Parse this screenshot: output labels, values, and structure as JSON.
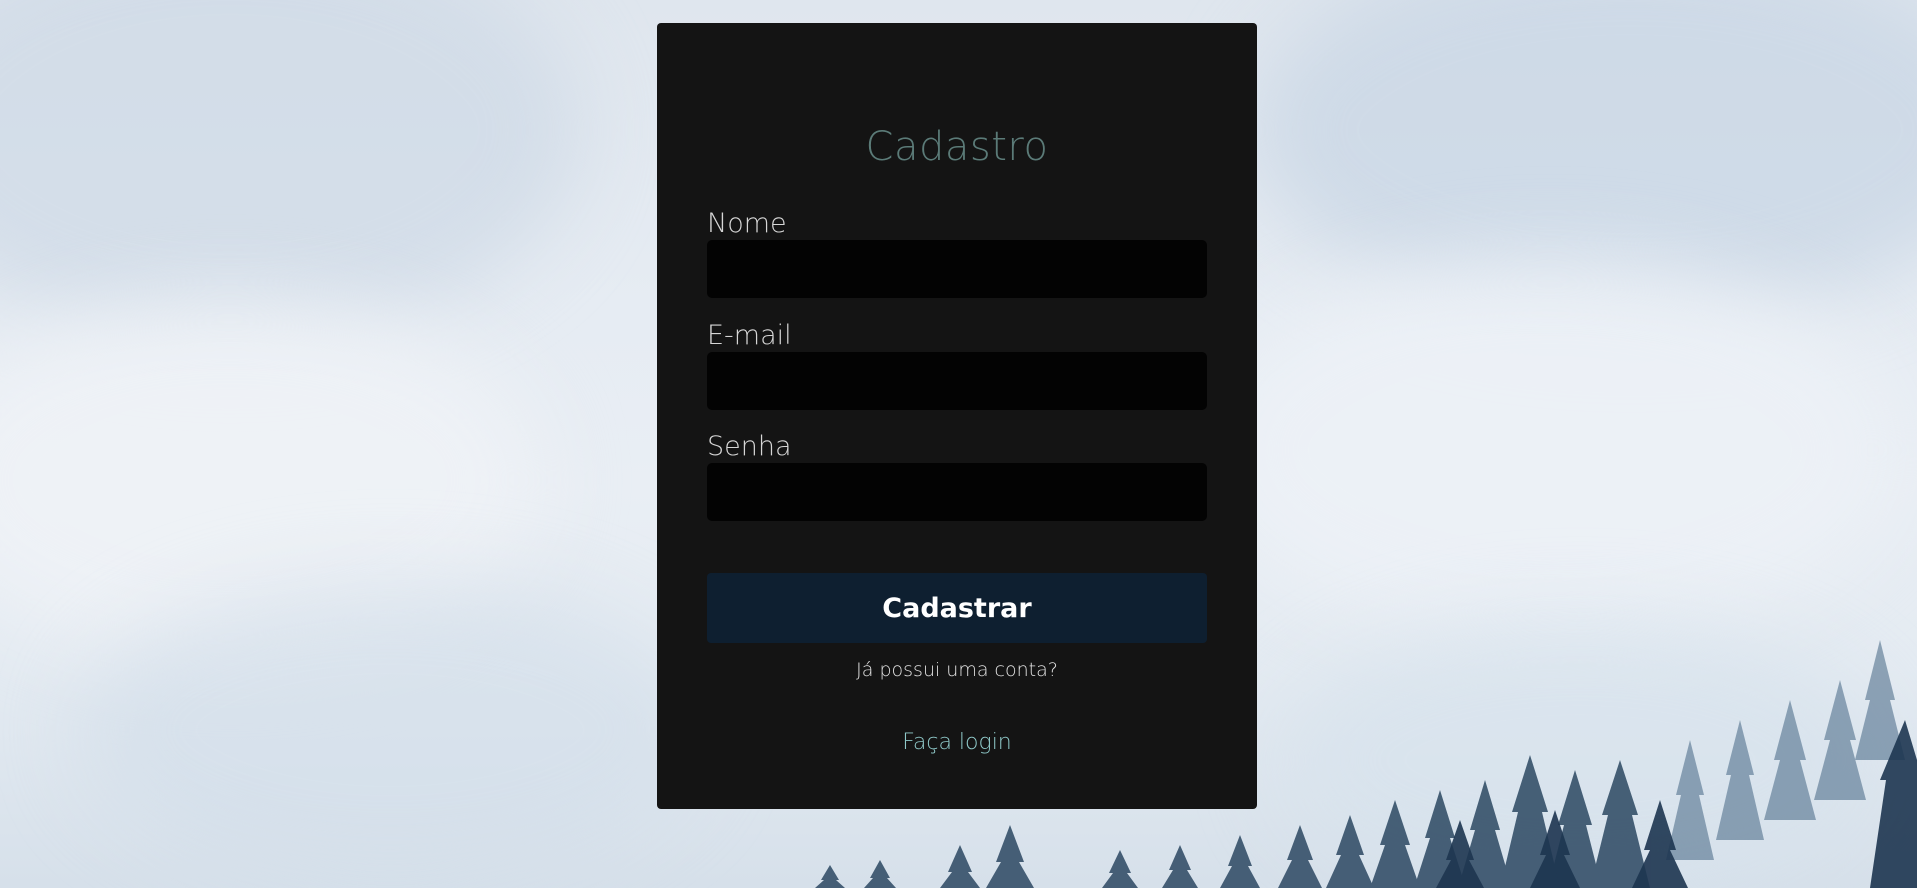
{
  "colors": {
    "card_background": "#141414",
    "title": "#5b7b78",
    "input_background": "#030303",
    "button_background": "#0e1f30",
    "link": "#8fc9c9"
  },
  "background": {
    "description_icon": "forest-fog-background"
  },
  "form": {
    "title": "Cadastro",
    "fields": [
      {
        "label": "Nome",
        "value": "",
        "placeholder": ""
      },
      {
        "label": "E-mail",
        "value": "",
        "placeholder": ""
      },
      {
        "label": "Senha",
        "value": "",
        "placeholder": ""
      }
    ],
    "submit_label": "Cadastrar",
    "hint": "Já possui uma conta?",
    "login_link": "Faça login"
  }
}
